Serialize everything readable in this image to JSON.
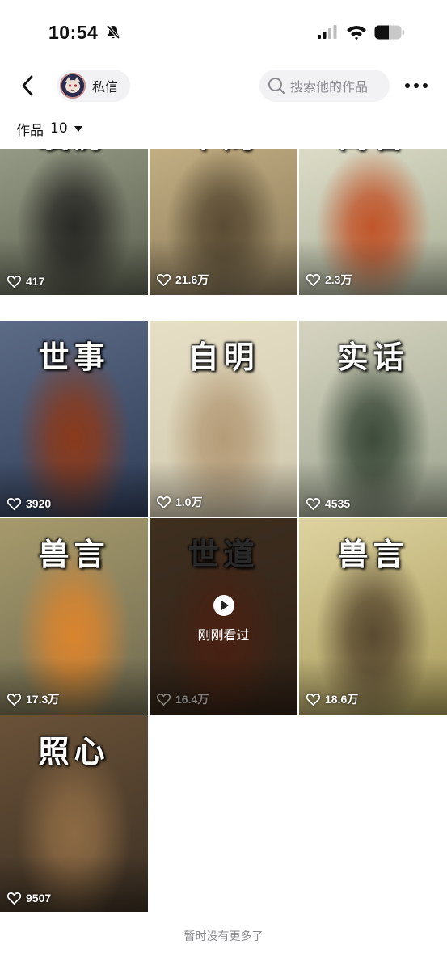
{
  "status_bar": {
    "time": "10:54",
    "icons": [
      "bell-off-icon",
      "cellular-signal-icon",
      "wifi-icon",
      "battery-icon"
    ]
  },
  "header": {
    "back_icon": "chevron-left-icon",
    "dm_label": "私信",
    "search_placeholder": "搜索他的作品",
    "more_icon": "more-dots-icon"
  },
  "works": {
    "label": "作品",
    "count": "10"
  },
  "grid": [
    {
      "title": "凌厉",
      "likes": "417",
      "colors": [
        "#5c6150",
        "#9aa08a",
        "#2a2a26"
      ]
    },
    {
      "title": "本周",
      "likes": "21.6万",
      "colors": [
        "#8a7a5a",
        "#c9b487",
        "#5a4c34"
      ]
    },
    {
      "title": "寓言",
      "likes": "2.3万",
      "colors": [
        "#a9b098",
        "#e2e0cc",
        "#c1552a"
      ]
    },
    {
      "title": "世事",
      "likes": "3920",
      "colors": [
        "#2f3c56",
        "#5c6b86",
        "#8a3a1c"
      ]
    },
    {
      "title": "自明",
      "likes": "1.0万",
      "colors": [
        "#cfc7ad",
        "#e6dfc6",
        "#b59c78"
      ]
    },
    {
      "title": "实话",
      "likes": "4535",
      "colors": [
        "#9aa38e",
        "#d6d4c0",
        "#3d4b3a"
      ]
    },
    {
      "title": "兽言",
      "likes": "17.3万",
      "colors": [
        "#6f6a50",
        "#a69a6c",
        "#d9842e"
      ]
    },
    {
      "title": "世道",
      "likes": "16.4万",
      "colors": [
        "#6a4a32",
        "#8a6a48",
        "#a04a2a"
      ],
      "viewed": true,
      "viewed_label": "刚刚看过"
    },
    {
      "title": "兽言",
      "likes": "18.6万",
      "colors": [
        "#a89a5a",
        "#ded3a0",
        "#5a4a30"
      ]
    },
    {
      "title": "照心",
      "likes": "9507",
      "colors": [
        "#3c3024",
        "#6a5238",
        "#8c6a44"
      ]
    }
  ],
  "footer": {
    "text": "暂时没有更多了"
  }
}
